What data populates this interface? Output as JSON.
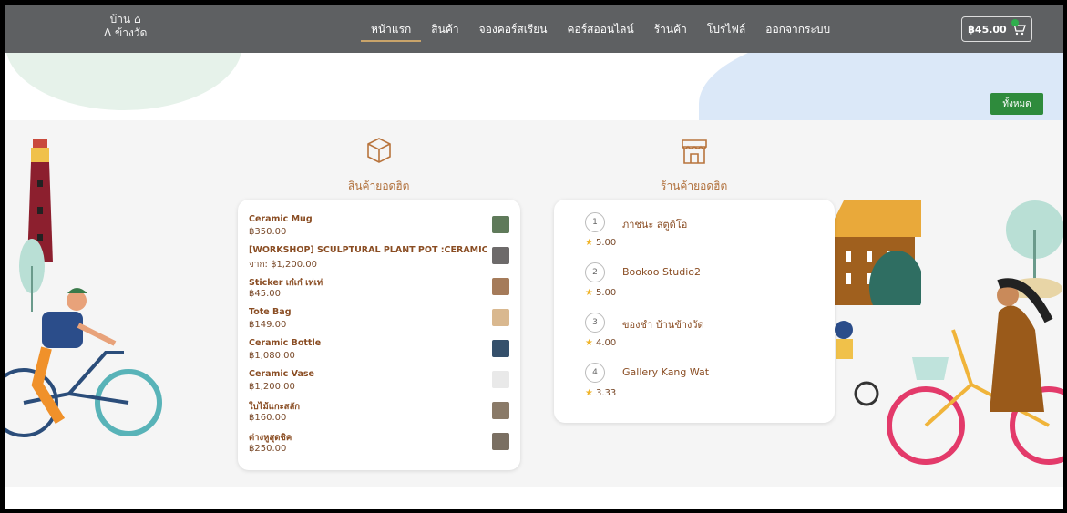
{
  "brand": {
    "logo_line1": "บ้าน ⌂",
    "logo_line2": "ᐱ ข้างวัด"
  },
  "nav": {
    "items": [
      "หน้าแรก",
      "สินค้า",
      "จองคอร์สเรียน",
      "คอร์สออนไลน์",
      "ร้านค้า",
      "โปรไฟล์",
      "ออกจากระบบ"
    ],
    "active_index": 0
  },
  "cart": {
    "amount": "฿45.00",
    "icon": "cart-icon"
  },
  "all_button": "ทั้งหมด",
  "popular_products": {
    "icon": "box-icon",
    "title": "สินค้ายอดฮิต",
    "items": [
      {
        "name": "Ceramic Mug",
        "price": "฿350.00",
        "thumb_color": "#5f7a5a"
      },
      {
        "name": "[WORKSHOP] SCULPTURAL PLANT POT :CERAMIC",
        "price": "จาก: ฿1,200.00",
        "thumb_color": "#6d6a6a"
      },
      {
        "name": "Sticker เก๋เก๋ เท่เท่",
        "price": "฿45.00",
        "thumb_color": "#a57b5a"
      },
      {
        "name": "Tote Bag",
        "price": "฿149.00",
        "thumb_color": "#d9b88f"
      },
      {
        "name": "Ceramic Bottle",
        "price": "฿1,080.00",
        "thumb_color": "#35506b"
      },
      {
        "name": "Ceramic Vase",
        "price": "฿1,200.00",
        "thumb_color": "#e9e9e9"
      },
      {
        "name": "ใบไม้แกะสลัก",
        "price": "฿160.00",
        "thumb_color": "#8a7a68"
      },
      {
        "name": "ต่างหูสุดชิค",
        "price": "฿250.00",
        "thumb_color": "#7a6f62"
      }
    ]
  },
  "popular_shops": {
    "icon": "storefront-icon",
    "title": "ร้านค้ายอดฮิต",
    "items": [
      {
        "rank": "1",
        "name": "ภาชนะ สตูดิโอ",
        "rating": "5.00"
      },
      {
        "rank": "2",
        "name": "Bookoo Studio2",
        "rating": "5.00"
      },
      {
        "rank": "3",
        "name": "ของชำ บ้านข้างวัด",
        "rating": "4.00"
      },
      {
        "rank": "4",
        "name": "Gallery Kang Wat",
        "rating": "3.33"
      }
    ]
  },
  "colors": {
    "accent": "#b06f3a",
    "nav_bg": "#5e6062",
    "button_green": "#2e8b3c",
    "star": "#f0b429"
  }
}
